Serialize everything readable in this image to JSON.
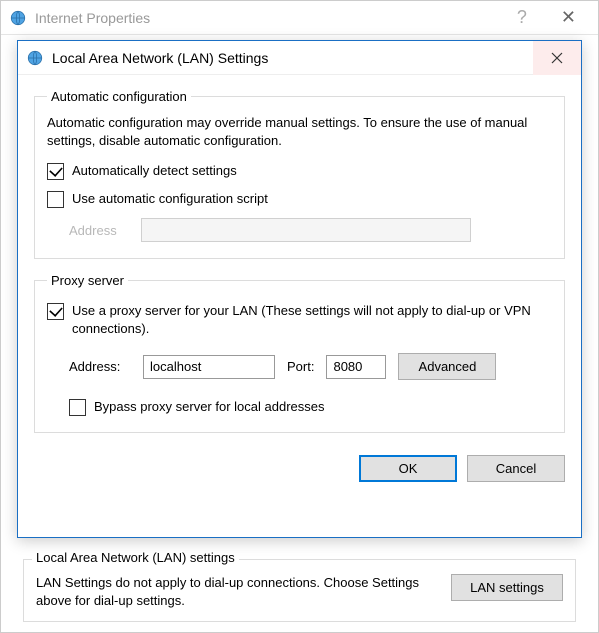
{
  "parent": {
    "title": "Internet Properties"
  },
  "lan_section": {
    "legend": "Local Area Network (LAN) settings",
    "desc": "LAN Settings do not apply to dial-up connections. Choose Settings above for dial-up settings.",
    "button": "LAN settings"
  },
  "dialog": {
    "title": "Local Area Network (LAN) Settings",
    "auto": {
      "legend": "Automatic configuration",
      "desc": "Automatic configuration may override manual settings.  To ensure the use of manual settings, disable automatic configuration.",
      "detect_label": "Automatically detect settings",
      "script_label": "Use automatic configuration script",
      "address_label": "Address"
    },
    "proxy": {
      "legend": "Proxy server",
      "use_label": "Use a proxy server for your LAN (These settings will not apply to dial-up or VPN connections).",
      "address_label": "Address:",
      "address_value": "localhost",
      "port_label": "Port:",
      "port_value": "8080",
      "advanced": "Advanced",
      "bypass_label": "Bypass proxy server for local addresses"
    },
    "ok": "OK",
    "cancel": "Cancel"
  }
}
